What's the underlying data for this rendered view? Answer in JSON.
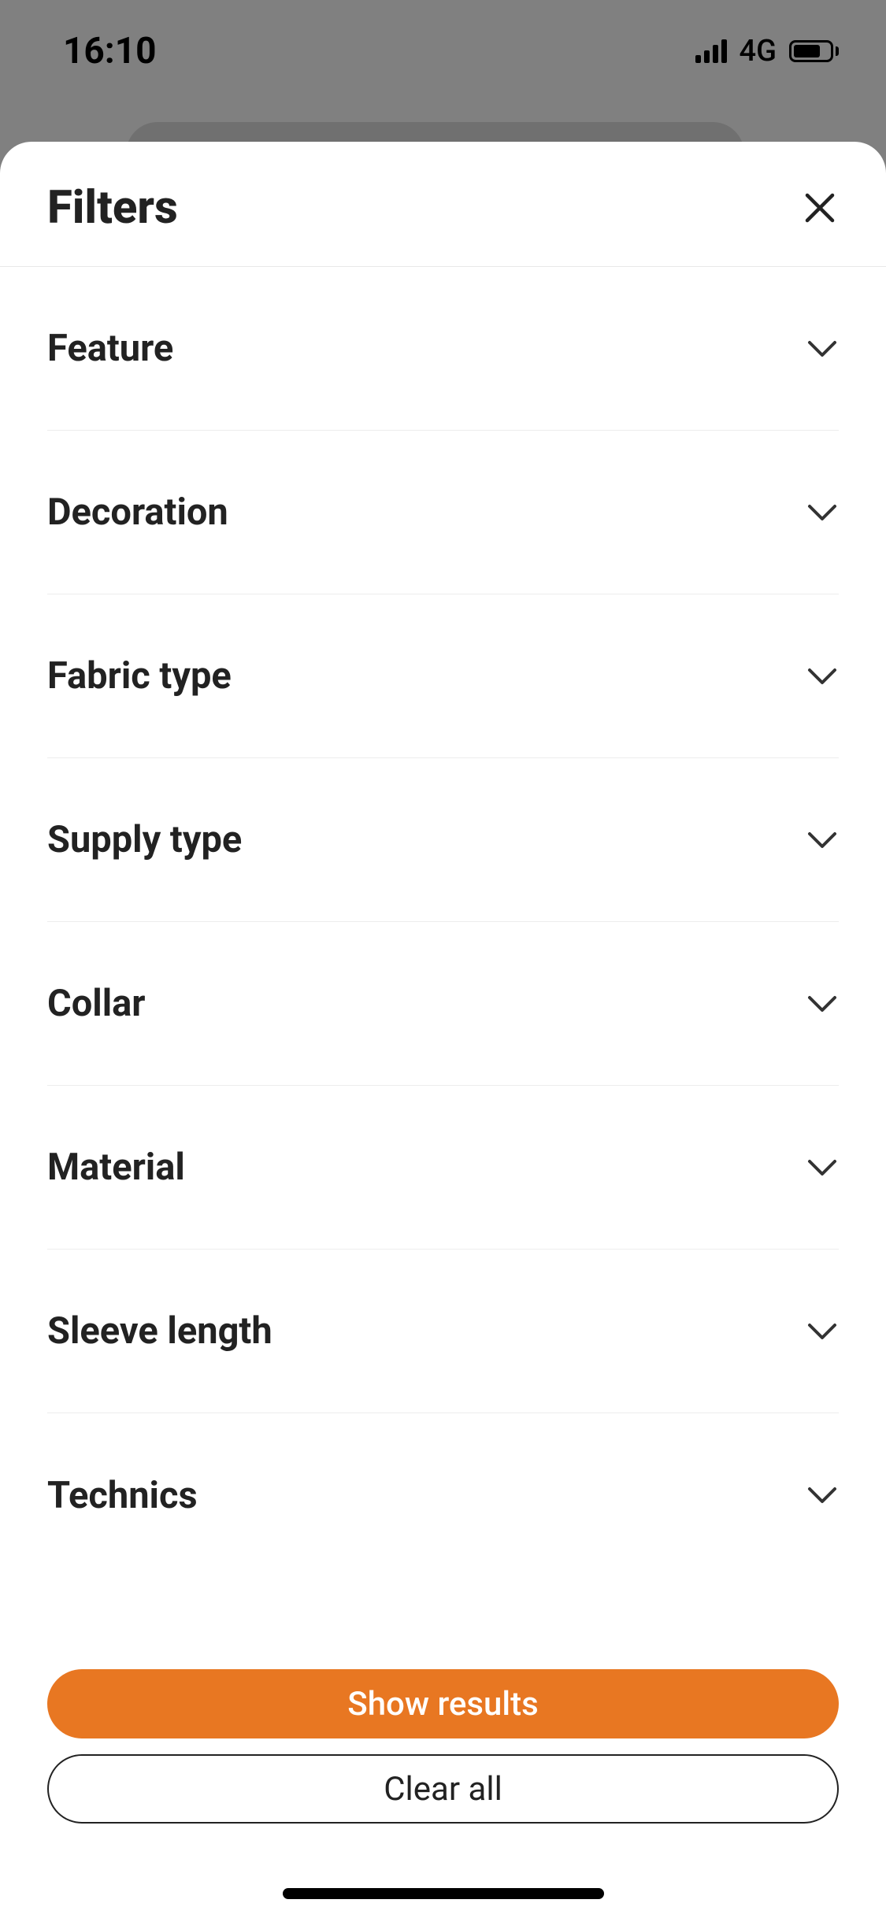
{
  "status": {
    "time": "16:10",
    "network": "4G"
  },
  "sheet": {
    "title": "Filters",
    "filters": [
      {
        "label": "Feature"
      },
      {
        "label": "Decoration"
      },
      {
        "label": "Fabric type"
      },
      {
        "label": "Supply type"
      },
      {
        "label": "Collar"
      },
      {
        "label": "Material"
      },
      {
        "label": "Sleeve length"
      },
      {
        "label": "Technics"
      }
    ],
    "actions": {
      "primary": "Show results",
      "secondary": "Clear all"
    }
  }
}
